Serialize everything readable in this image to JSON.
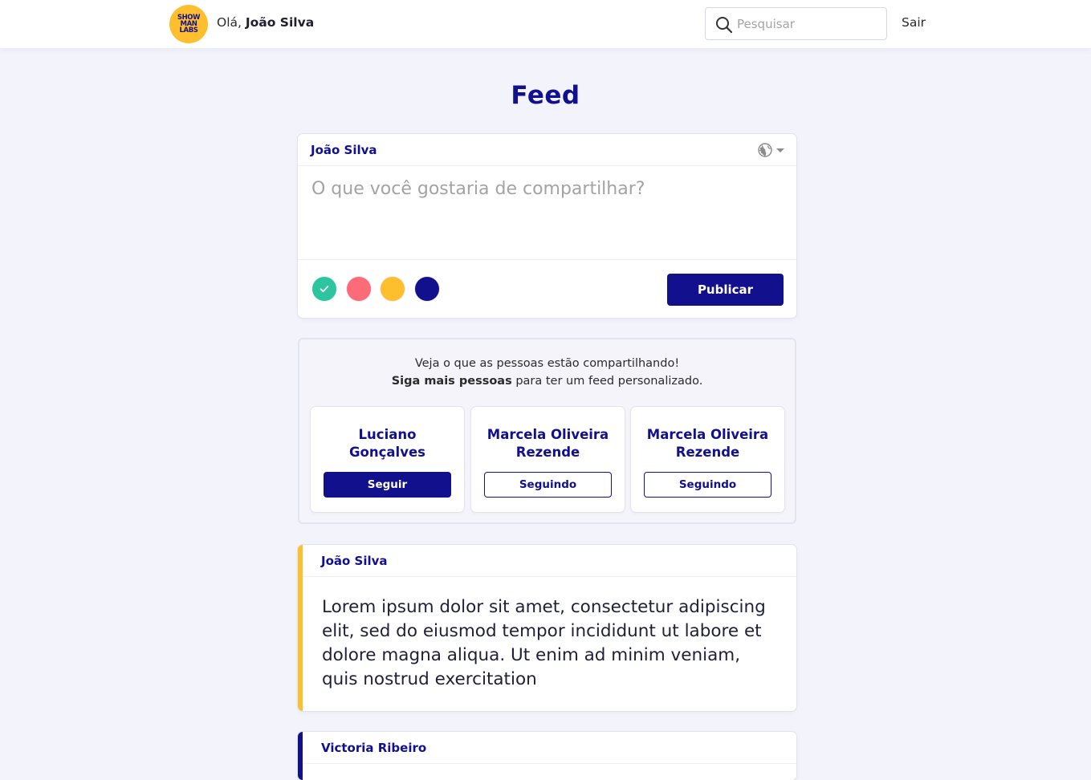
{
  "header": {
    "logo_text": [
      "SHOW",
      "MAN",
      "LABS"
    ],
    "greeting_prefix": "Olá,",
    "user_name": "João Silva",
    "search_placeholder": "Pesquisar",
    "logout_label": "Sair"
  },
  "page": {
    "title": "Feed"
  },
  "composer": {
    "author": "João Silva",
    "placeholder": "O que você gostaria de compartilhar?",
    "privacy_icon": "globe-icon",
    "colors": [
      {
        "name": "green",
        "hex": "#2cc5a0",
        "selected": true
      },
      {
        "name": "red",
        "hex": "#fc6b78",
        "selected": false
      },
      {
        "name": "yellow",
        "hex": "#fdbf2d",
        "selected": false
      },
      {
        "name": "navy",
        "hex": "#12108c",
        "selected": false
      }
    ],
    "publish_label": "Publicar"
  },
  "suggestions": {
    "line1": "Veja o que as pessoas estão compartilhando!",
    "line2_bold": "Siga mais pessoas",
    "line2_rest": " para ter um feed personalizado.",
    "people": [
      {
        "name": "Luciano Gonçalves",
        "button": "Seguir",
        "following": false
      },
      {
        "name": "Marcela Oliveira Rezende",
        "button": "Seguindo",
        "following": true
      },
      {
        "name": "Marcela Oliveira Rezende",
        "button": "Seguindo",
        "following": true
      }
    ]
  },
  "posts": [
    {
      "author": "João Silva",
      "color": "#fdbf2d",
      "text": "Lorem ipsum dolor sit amet, consectetur adipiscing elit, sed do eiusmod tempor incididunt ut labore et dolore magna aliqua. Ut enim ad minim veniam, quis nostrud exercitation"
    },
    {
      "author": "Victoria Ribeiro",
      "color": "#12108c",
      "text": ""
    }
  ],
  "colors": {
    "primary": "#12108c",
    "accent": "#fdbf2d",
    "background": "#f3f4fb"
  }
}
